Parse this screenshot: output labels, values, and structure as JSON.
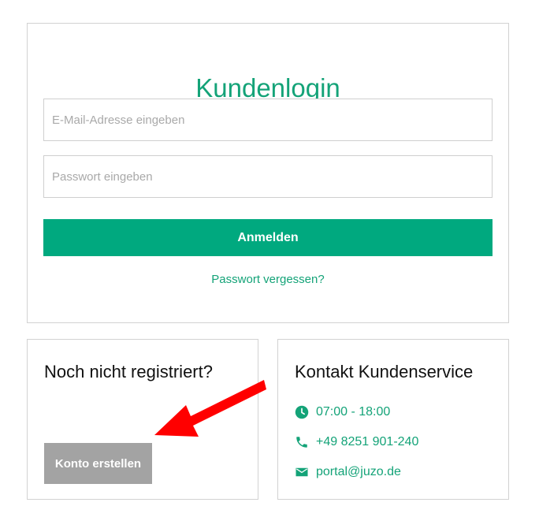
{
  "login": {
    "title": "Kundenlogin",
    "email_placeholder": "E-Mail-Adresse eingeben",
    "password_placeholder": "Passwort eingeben",
    "submit_label": "Anmelden",
    "forgot_label": "Passwort vergessen?"
  },
  "register": {
    "title": "Noch nicht registriert?",
    "button_label": "Konto erstellen"
  },
  "contact": {
    "title": "Kontakt Kundenservice",
    "hours": "07:00 - 18:00",
    "phone": "+49 8251 901-240",
    "email": "portal@juzo.de",
    "icons": [
      "clock-icon",
      "phone-icon",
      "mail-icon"
    ]
  },
  "colors": {
    "brand_green": "#00a97f",
    "link_green": "#14a378",
    "register_gray": "#a3a3a3",
    "annotation_arrow": "#ff0000"
  }
}
